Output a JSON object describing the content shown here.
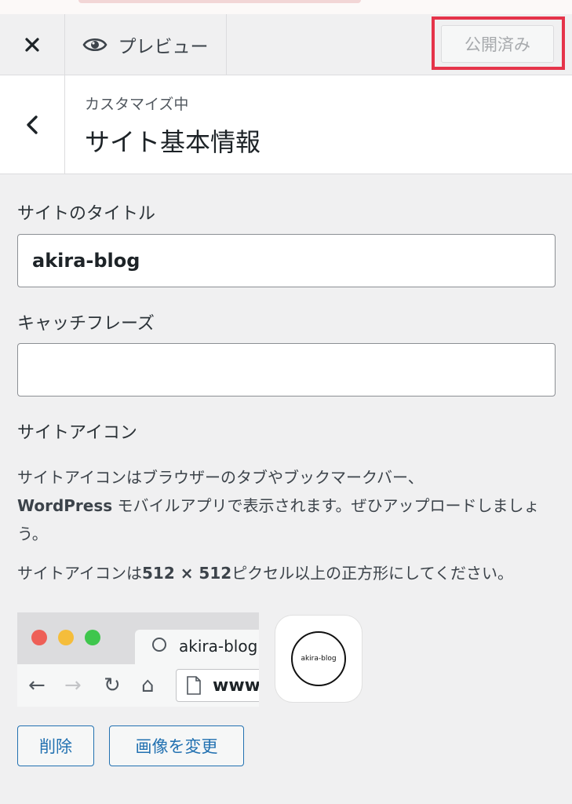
{
  "header": {
    "close_icon": "close-icon",
    "preview_label": "プレビュー",
    "preview_icon": "eye-icon",
    "publish_label": "公開済み",
    "highlight_color": "#e5344a"
  },
  "section": {
    "back_icon": "chevron-left-icon",
    "customizing_label": "カスタマイズ中",
    "title": "サイト基本情報"
  },
  "site_title": {
    "label": "サイトのタイトル",
    "value": "akira-blog"
  },
  "tagline": {
    "label": "キャッチフレーズ",
    "value": ""
  },
  "site_icon": {
    "label": "サイトアイコン",
    "description_part1": "サイトアイコンはブラウザーのタブやブックマークバー、",
    "description_bold": "WordPress",
    "description_part2": " モバイルアプリで表示されます。ぜひアップロードしましょう。",
    "size_note_prefix": "サイトアイコンは",
    "size_note_bold": "512 × 512",
    "size_note_suffix": "ピクセル以上の正方形にしてください。",
    "preview": {
      "tab_title": "akira-blog",
      "url_text": "www.",
      "app_icon_text": "akira-blog"
    },
    "remove_label": "削除",
    "change_label": "画像を変更"
  }
}
